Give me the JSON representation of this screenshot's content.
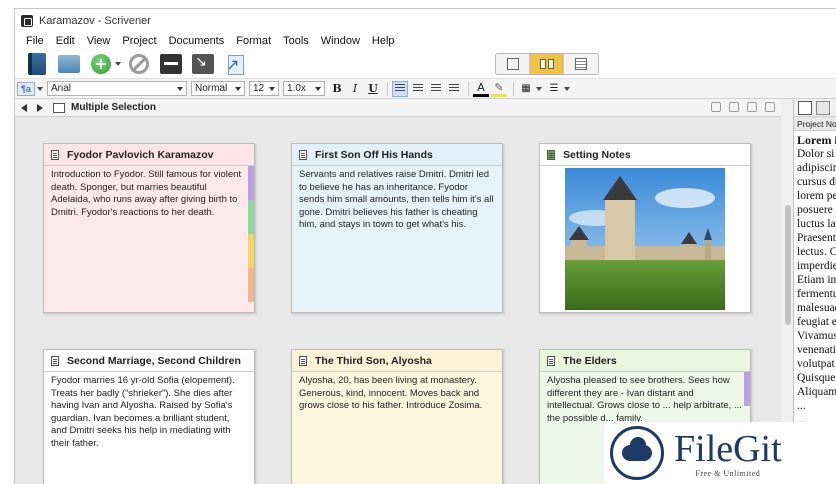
{
  "window": {
    "title": "Karamazov - Scrivener"
  },
  "menu": [
    "File",
    "Edit",
    "View",
    "Project",
    "Documents",
    "Format",
    "Tools",
    "Window",
    "Help"
  ],
  "toolbar": {
    "icons": [
      "binder-icon",
      "collections-icon",
      "add-icon",
      "trash-icon",
      "keywords-icon",
      "fullscreen-icon",
      "compile-icon"
    ],
    "view_modes": [
      "scrivenings",
      "corkboard",
      "outliner"
    ],
    "active_view": "corkboard"
  },
  "format_bar": {
    "font": "Arial",
    "style": "Normal",
    "size": "12",
    "line_spacing": "1.0x",
    "bold": "B",
    "italic": "I",
    "underline": "U"
  },
  "nav": {
    "title": "Multiple Selection"
  },
  "cards": [
    {
      "title": "Fyodor Pavlovich Karamazov",
      "body": "Introduction to Fyodor. Still famous for violent death. Sponger, but marries beautiful Adelaida, who runs away after giving birth to Dmitri. Fyodor's reactions to her death.",
      "bg": "#fde8ec",
      "head_bg": "#fce4e8",
      "labels": [
        "#b9a0e0",
        "#8fd6a0",
        "#f0d860",
        "#f0b890"
      ]
    },
    {
      "title": "First Son Off His Hands",
      "body": "Servants and relatives raise Dmitri. Dmitri led to believe he has an inheritance. Fyodor sends him small amounts, then tells him it's all gone. Dmitri believes his father is cheating him, and stays in town to get what's his.",
      "bg": "#e6f2fa",
      "head_bg": "#e2f0fa",
      "labels": []
    },
    {
      "title": "Setting Notes",
      "body": "",
      "bg": "#ffffff",
      "head_bg": "#ffffff",
      "labels": []
    },
    {
      "title": "Second Marriage, Second Children",
      "body": "Fyodor marries 16 yr-old Sofia (elopement). Treats her badly (“shrieker”). She dies after having Ivan and Alyosha. Raised by Sofia's guardian. Ivan becomes a brilliant student, and Dmitri seeks his help in mediating with their father.",
      "bg": "#ffffff",
      "head_bg": "#ffffff",
      "labels": []
    },
    {
      "title": "The Third Son, Alyosha",
      "body": "Alyosha, 20, has been living at monastery. Generous, kind, innocent. Moves back and grows close to his father. Introduce Zosima.",
      "bg": "#fdf6dc",
      "head_bg": "#fdf2d6",
      "labels": []
    },
    {
      "title": "The Elders",
      "body": "Alyosha pleased to see brothers. Sees how different they are - Ivan distant and intellectual. Grows close to ... help arbitrate, ... the possible d... family.",
      "bg": "#eef8e8",
      "head_bg": "#e8f6e0",
      "labels": [
        "#b9a0e0"
      ]
    }
  ],
  "inspector": {
    "header": "Project Notes",
    "lines": [
      "Lorem ips",
      "   Dolor si",
      "adipiscing",
      "cursus dui",
      "lorem pelle",
      "posuere lig",
      "luctus laore",
      "Praesent a",
      "lectus. Cur",
      "imperdiet.",
      "   Etiam in",
      "fermentum",
      "malesuada",
      "feugiat era",
      "Vivamus v",
      "venenatis e",
      "volutpat lo",
      "Quisque v",
      "Aliquam p",
      "...",
      "..."
    ]
  },
  "watermark": {
    "name": "FileGit",
    "tag": "Free & Unlimited"
  }
}
